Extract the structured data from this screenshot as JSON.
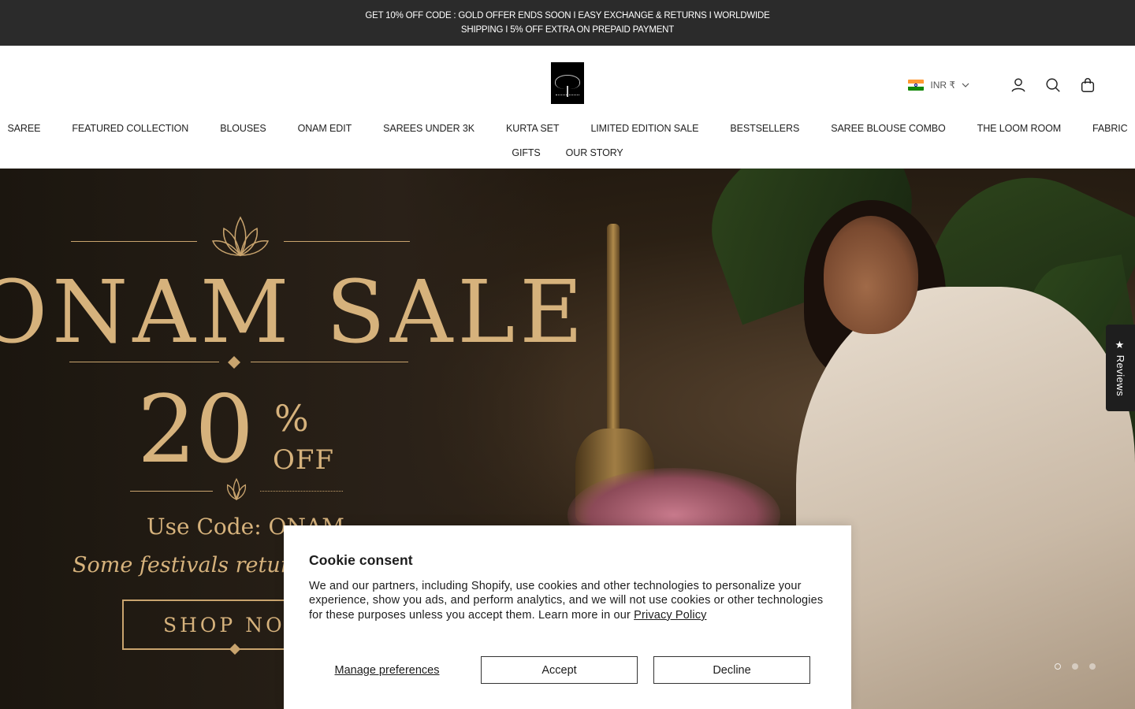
{
  "announcement": {
    "text": "GET 10% OFF CODE : GOLD OFFER ENDS SOON I EASY EXCHANGE & RETURNS I WORLDWIDE SHIPPING I 5% OFF EXTRA ON PREPAID PAYMENT"
  },
  "header": {
    "currency": "INR ₹",
    "icons": [
      "account-icon",
      "search-icon",
      "cart-icon"
    ]
  },
  "nav": {
    "row1": [
      "SAREE",
      "FEATURED COLLECTION",
      "BLOUSES",
      "ONAM EDIT",
      "SAREES UNDER 3K",
      "KURTA SET",
      "LIMITED EDITION SALE",
      "BESTSELLERS",
      "SAREE BLOUSE COMBO",
      "THE LOOM ROOM",
      "FABRIC"
    ],
    "row2": [
      "GIFTS",
      "OUR STORY"
    ]
  },
  "hero": {
    "title": "ONAM SALE",
    "percent": "20",
    "percent_sign": "%",
    "off": "OFF",
    "code_label": "Use Code: ONAM",
    "tagline": "Some festivals return first",
    "cta": "SHOP NOW",
    "slides_total": 3,
    "slide_active": 1
  },
  "reviews_tab": "★ Reviews",
  "cookie": {
    "title": "Cookie consent",
    "body": "We and our partners, including Shopify, use cookies and other technologies to personalize your experience, show you ads, and perform analytics, and we will not use cookies or other technologies for these purposes unless you accept them. Learn more in our ",
    "link": "Privacy Policy",
    "manage": "Manage preferences",
    "accept": "Accept",
    "decline": "Decline"
  },
  "colors": {
    "announcement_bg": "#2b2b2b",
    "gold": "#d6b27c"
  }
}
